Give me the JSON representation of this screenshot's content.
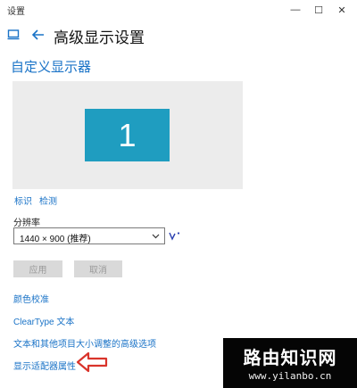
{
  "window": {
    "title": "设置",
    "controls": {
      "minimize": "—",
      "maximize": "☐",
      "close": "✕"
    }
  },
  "header": {
    "title": "高级显示设置",
    "home_icon": "monitor-icon",
    "back_icon": "back-arrow-icon"
  },
  "display": {
    "section_title": "自定义显示器",
    "monitor_number": "1",
    "identify_label": "标识",
    "detect_label": "检测"
  },
  "resolution": {
    "label": "分辨率",
    "value": "1440 × 900 (推荐)"
  },
  "buttons": {
    "apply": "应用",
    "cancel": "取消"
  },
  "links": {
    "color_calibration": "颜色校准",
    "cleartype": "ClearType 文本",
    "advanced_text_size": "文本和其他项目大小调整的高级选项",
    "adapter_properties": "显示适配器属性"
  },
  "watermark": {
    "title": "路由知识网",
    "url": "www.yilanbo.cn"
  },
  "colors": {
    "accent": "#1a73c7",
    "monitor_tile": "#1f9dc0",
    "arrow": "#d9342b"
  }
}
